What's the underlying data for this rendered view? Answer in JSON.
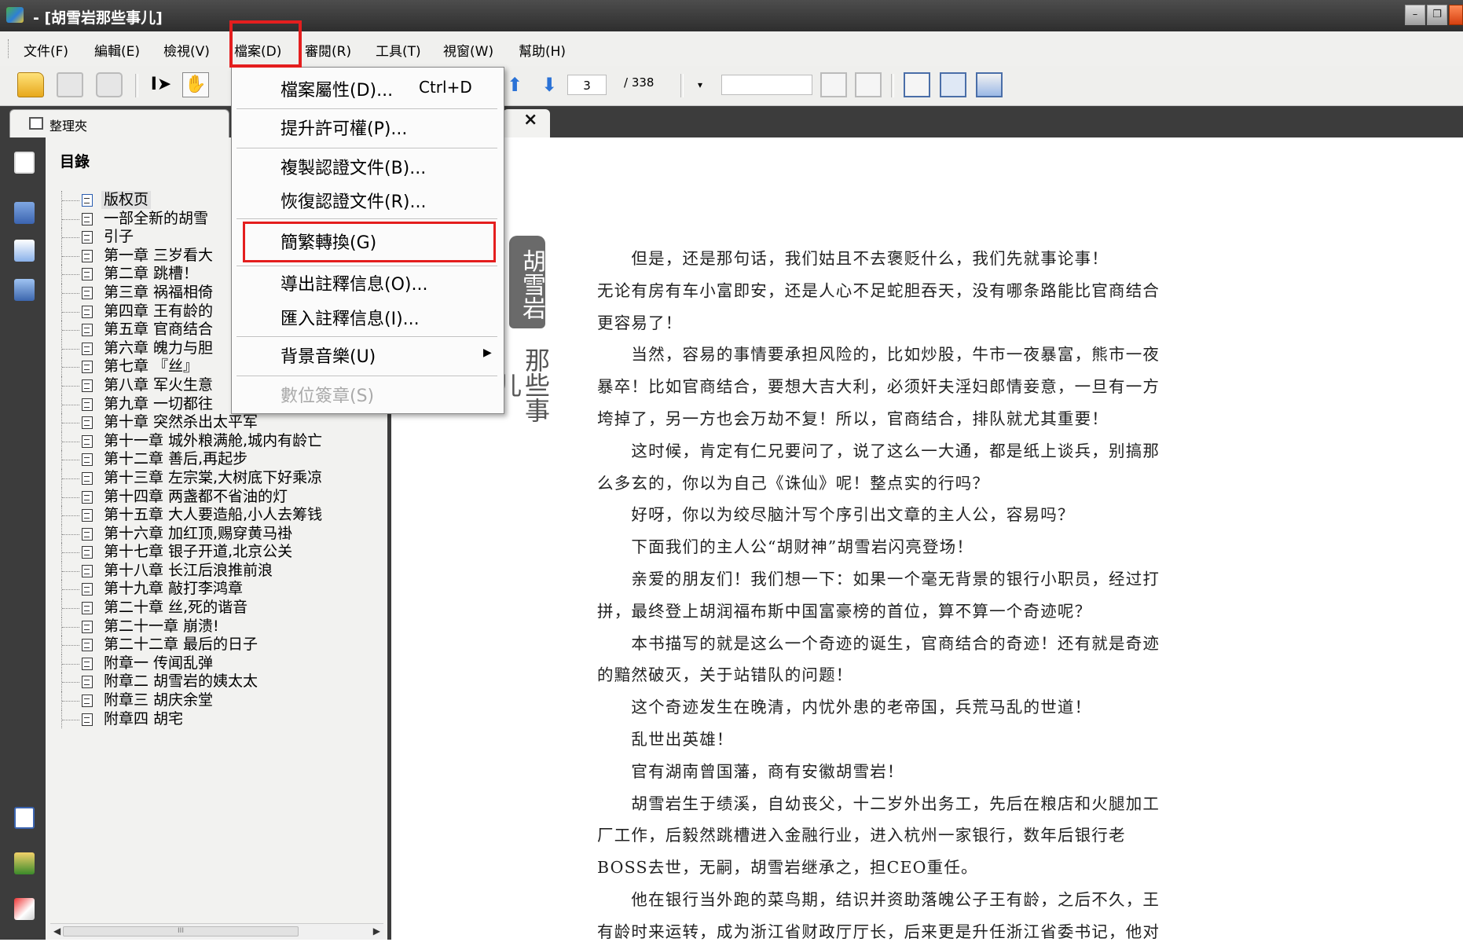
{
  "window": {
    "title": " - [胡雪岩那些事儿]"
  },
  "menu": [
    {
      "id": "file",
      "label": "文件(F)"
    },
    {
      "id": "edit",
      "label": "編輯(E)"
    },
    {
      "id": "view",
      "label": "檢視(V)"
    },
    {
      "id": "archive",
      "label": "檔案(D)"
    },
    {
      "id": "review",
      "label": "審閱(R)"
    },
    {
      "id": "tools",
      "label": "工具(T)"
    },
    {
      "id": "window",
      "label": "視窗(W)"
    },
    {
      "id": "help",
      "label": "幫助(H)"
    }
  ],
  "toolbar": {
    "current_page": "3",
    "total_pages": "/ 338",
    "zoom_value": ""
  },
  "tabs": {
    "panel_label": "整理夾",
    "doc_close": "×"
  },
  "sidebar": {
    "header": "目錄",
    "toc": [
      "版权页",
      "一部全新的胡雪",
      "引子",
      "第一章 三岁看大",
      "第二章 跳槽！",
      "第三章 祸福相倚",
      "第四章 王有龄的",
      "第五章 官商结合",
      "第六章 魄力与胆",
      "第七章 『丝』",
      "第八章 军火生意",
      "第九章 一切都往",
      "第十章 突然杀出太平军",
      "第十一章 城外粮满舱,城内有龄亡",
      "第十二章 善后,再起步",
      "第十三章 左宗棠,大树底下好乘凉",
      "第十四章 两盏都不省油的灯",
      "第十五章 大人要造船,小人去筹钱",
      "第十六章 加红顶,赐穿黄马褂",
      "第十七章 银子开道,北京公关",
      "第十八章 长江后浪推前浪",
      "第十九章 敲打李鸿章",
      "第二十章 丝,死的谐音",
      "第二十一章 崩溃!",
      "第二十二章 最后的日子",
      "附章一 传闻乱弹",
      "附章二 胡雪岩的姨太太",
      "附章三 胡庆余堂",
      "附章四 胡宅"
    ],
    "scroll_thumb": "III"
  },
  "dropdown": {
    "items": [
      {
        "label": "檔案屬性(D)...",
        "shortcut": "Ctrl+D"
      },
      {
        "label": "提升許可權(P)..."
      },
      {
        "label": "複製認證文件(B)..."
      },
      {
        "label": "恢復認證文件(R)..."
      },
      {
        "label": "簡繁轉換(G)"
      },
      {
        "label": "導出註釋信息(O)..."
      },
      {
        "label": "匯入註釋信息(I)..."
      },
      {
        "label": "背景音樂(U)",
        "submenu_arrow": "▶"
      },
      {
        "label": "數位簽章(S)"
      }
    ]
  },
  "document": {
    "seal_text": "胡雪岩",
    "seal_sub": "那些事儿",
    "lines": [
      "　　但是，还是那句话，我们姑且不去褒贬什么，我们先就事论事！",
      "无论有房有车小富即安，还是人心不足蛇胆吞天，没有哪条路能比官商结合",
      "更容易了！",
      "　　当然，容易的事情要承担风险的，比如炒股，牛市一夜暴富，熊市一夜",
      "暴卒！比如官商结合，要想大吉大利，必须奸夫淫妇郎情妾意，一旦有一方",
      "垮掉了，另一方也会万劫不复！所以，官商结合，排队就尤其重要！",
      "　　这时候，肯定有仁兄要问了，说了这么一大通，都是纸上谈兵，别搞那",
      "么多玄的，你以为自己《诛仙》呢！整点实的行吗？",
      "　　好呀，你以为绞尽脑汁写个序引出文章的主人公，容易吗？",
      "　　下面我们的主人公“胡财神”胡雪岩闪亮登场！",
      "　　亲爱的朋友们！我们想一下：如果一个毫无背景的银行小职员，经过打",
      "拼，最终登上胡润福布斯中国富豪榜的首位，算不算一个奇迹呢？",
      "　　本书描写的就是这么一个奇迹的诞生，官商结合的奇迹！还有就是奇迹",
      "的黯然破灭，关于站错队的问题！",
      "　　这个奇迹发生在晚清，内忧外患的老帝国，兵荒马乱的世道！",
      "　　乱世出英雄！",
      "　　官有湖南曾国藩，商有安徽胡雪岩！",
      "　　胡雪岩生于绩溪，自幼丧父，十二岁外出务工，先后在粮店和火腿加工",
      "厂工作，后毅然跳槽进入金融行业，进入杭州一家银行，数年后银行老",
      "BOSS去世，无嗣，胡雪岩继承之，担CEO重任。",
      "　　他在银行当外跑的菜鸟期，结识并资助落魄公子王有龄，之后不久，王",
      "有龄时来运转，成为浙江省财政厅厅长，后来更是升任浙江省委书记，他对"
    ]
  }
}
